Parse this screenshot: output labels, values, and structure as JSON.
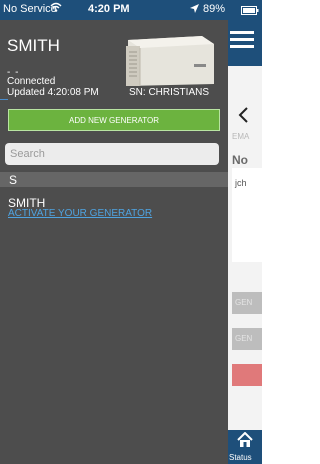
{
  "status_bar": {
    "carrier": "No Service",
    "time": "4:20 PM",
    "battery": "89%"
  },
  "generator": {
    "name": "SMITH",
    "dashes": "- -",
    "connection": "Connected",
    "updated": "Updated 4:20:08 PM",
    "serial": "SN: CHRISTIANS"
  },
  "add_button_label": "ADD NEW GENERATOR",
  "search": {
    "placeholder": "Search"
  },
  "section_header": "S",
  "list": [
    {
      "name": "SMITH",
      "link": "ACTIVATE YOUR GENERATOR"
    }
  ],
  "right_panel": {
    "email_label": "EMA",
    "notif_label": "No",
    "entry_text": "jch",
    "button1": "GEN",
    "button2": "GEN",
    "status_label": "Status"
  },
  "colors": {
    "nav_blue": "#1e4f7a",
    "panel_gray": "#4d4d4d",
    "add_green": "#6cb33f",
    "link_blue": "#4fa3e0",
    "danger_red": "#e0797a"
  }
}
